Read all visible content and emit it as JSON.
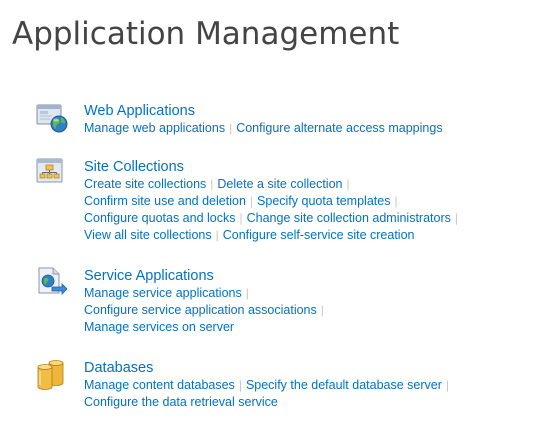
{
  "page": {
    "title": "Application Management"
  },
  "separator": "|",
  "sections": {
    "web_applications": {
      "heading": "Web Applications",
      "links": {
        "manage_web_applications": "Manage web applications",
        "configure_alternate_access_mappings": "Configure alternate access mappings"
      }
    },
    "site_collections": {
      "heading": "Site Collections",
      "links": {
        "create_site_collections": "Create site collections",
        "delete_site_collection": "Delete a site collection",
        "confirm_site_use": "Confirm site use and deletion",
        "specify_quota_templates": "Specify quota templates",
        "configure_quotas_and_locks": "Configure quotas and locks",
        "change_site_collection_administrators": "Change site collection administrators",
        "view_all_site_collections": "View all site collections",
        "configure_self_service": "Configure self-service site creation"
      }
    },
    "service_applications": {
      "heading": "Service Applications",
      "links": {
        "manage_service_applications": "Manage service applications",
        "configure_service_application_associations": "Configure service application associations",
        "manage_services_on_server": "Manage services on server"
      }
    },
    "databases": {
      "heading": "Databases",
      "links": {
        "manage_content_databases": "Manage content databases",
        "specify_default_database_server": "Specify the default database server",
        "configure_data_retrieval_service": "Configure the data retrieval service"
      }
    }
  },
  "icons": {
    "web_applications": "web-application-globe-icon",
    "site_collections": "site-hierarchy-icon",
    "service_applications": "service-application-icon",
    "databases": "database-cylinders-icon"
  },
  "colors": {
    "link": "#0072c6",
    "title": "#444444",
    "separator": "#c6c6c6"
  }
}
